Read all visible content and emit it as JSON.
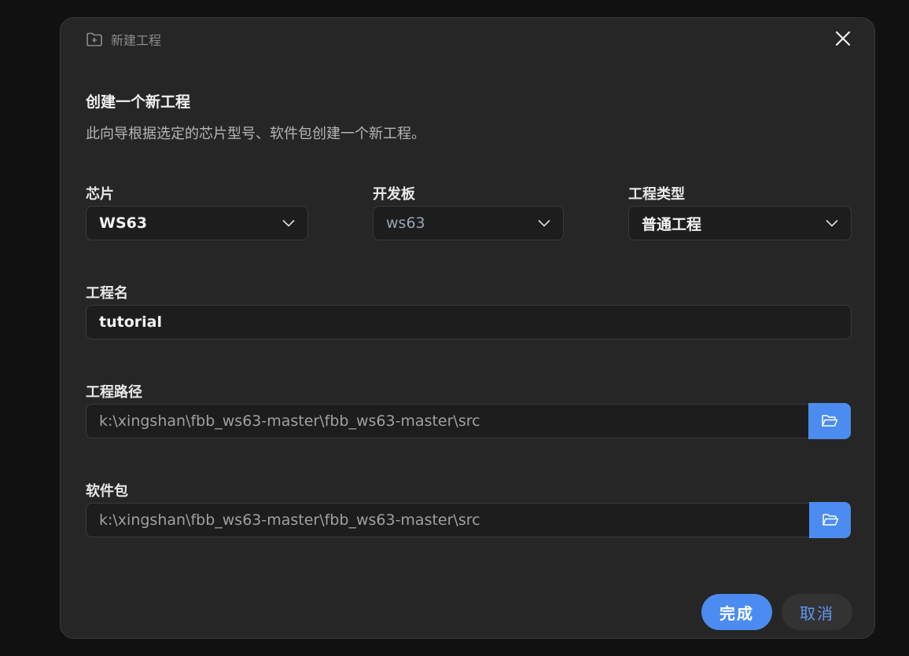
{
  "dialog": {
    "title": "新建工程",
    "heading": "创建一个新工程",
    "subheading": "此向导根据选定的芯片型号、软件包创建一个新工程。"
  },
  "fields": {
    "chip": {
      "label": "芯片",
      "value": "WS63"
    },
    "board": {
      "label": "开发板",
      "value": "ws63"
    },
    "project_type": {
      "label": "工程类型",
      "value": "普通工程"
    },
    "project_name": {
      "label": "工程名",
      "value": "tutorial"
    },
    "project_path": {
      "label": "工程路径",
      "value": "k:\\xingshan\\fbb_ws63-master\\fbb_ws63-master\\src"
    },
    "package": {
      "label": "软件包",
      "value": "k:\\xingshan\\fbb_ws63-master\\fbb_ws63-master\\src"
    }
  },
  "buttons": {
    "finish": "完成",
    "cancel": "取消"
  },
  "icons": {
    "title": "folder-plus-icon",
    "close": "close-icon",
    "dropdown": "chevron-down-icon",
    "browse": "folder-open-icon"
  },
  "colors": {
    "accent": "#4c8cf0",
    "dialog_bg": "#262626",
    "field_bg": "#1d1d1d"
  }
}
